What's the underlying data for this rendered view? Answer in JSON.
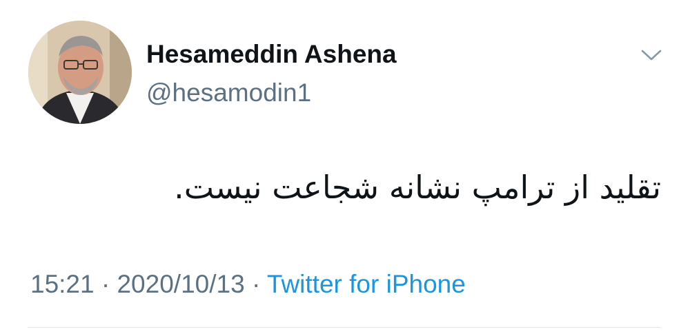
{
  "user": {
    "display_name": "Hesameddin Ashena",
    "handle": "@hesamodin1",
    "avatar_icon": "profile-photo"
  },
  "tweet": {
    "text": "تقلید از ترامپ نشانه شجاعت نیست.",
    "time": "15:21",
    "separator": "·",
    "date": "2020/10/13",
    "source": "Twitter for iPhone"
  },
  "menu": {
    "icon": "chevron-down-icon"
  },
  "colors": {
    "name": "#0f1419",
    "secondary": "#5b7083",
    "link": "#1b95e0",
    "divider": "#e1e8ed"
  }
}
